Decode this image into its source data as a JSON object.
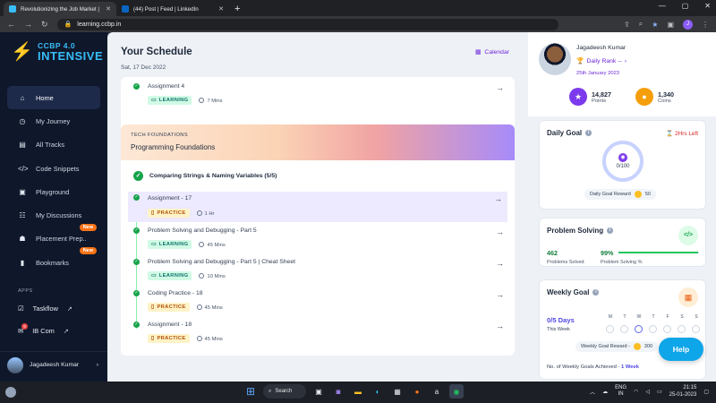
{
  "browser": {
    "tabs": [
      {
        "title": "Revolutionizing the Job Market |",
        "active": true,
        "icon": "ccbp-favicon"
      },
      {
        "title": "(44) Post | Feed | LinkedIn",
        "active": false,
        "icon": "linkedin-favicon"
      }
    ],
    "url": "learning.ccbp.in"
  },
  "sidebar": {
    "logo_line1": "CCBP 4.0",
    "logo_line2": "INTENSIVE",
    "items": [
      {
        "label": "Home",
        "icon": "home-icon",
        "active": true
      },
      {
        "label": "My Journey",
        "icon": "journey-icon"
      },
      {
        "label": "All Tracks",
        "icon": "tracks-icon"
      },
      {
        "label": "Code Snippets",
        "icon": "code-icon"
      },
      {
        "label": "Playground",
        "icon": "playground-icon"
      },
      {
        "label": "My Discussions",
        "icon": "discussion-icon"
      },
      {
        "label": "Placement Prep..",
        "icon": "placement-icon",
        "badge": "New"
      },
      {
        "label": "Bookmarks",
        "icon": "bookmark-icon",
        "badge": "New"
      }
    ],
    "apps_label": "APPS",
    "apps": [
      {
        "label": "Taskflow",
        "icon": "taskflow-icon"
      },
      {
        "label": "IB Com",
        "icon": "ibcom-icon",
        "count": "9"
      }
    ],
    "user_name": "Jagadeesh Kumar"
  },
  "schedule": {
    "title": "Your Schedule",
    "date": "Sat, 17 Dec 2022",
    "calendar_label": "Calendar",
    "top_item": {
      "title": "Assignment 4",
      "tag": "LEARNING",
      "duration": "7 Mins"
    },
    "section": {
      "banner_sub": "TECH FOUNDATIONS",
      "banner_title": "Programming Foundations",
      "heading": "Comparing Strings & Naming Variables (5/5)",
      "items": [
        {
          "title": "Assignment - 17",
          "tag": "PRACTICE",
          "duration": "1 Hr"
        },
        {
          "title": "Problem Solving and Debugging - Part 5",
          "tag": "LEARNING",
          "duration": "45 Mins"
        },
        {
          "title": "Problem Solving and Debugging - Part 5 | Cheat Sheet",
          "tag": "LEARNING",
          "duration": "10 Mins"
        },
        {
          "title": "Coding Practice - 18",
          "tag": "PRACTICE",
          "duration": "45 Mins"
        },
        {
          "title": "Assignment - 18",
          "tag": "PRACTICE",
          "duration": "45 Mins"
        }
      ]
    }
  },
  "profile": {
    "name": "Jagadeesh Kumar",
    "rank": "Daily Rank --",
    "date": "25th January 2023",
    "points_value": "14,827",
    "points_label": "Points",
    "coins_value": "1,340",
    "coins_label": "Coins"
  },
  "daily_goal": {
    "title": "Daily Goal",
    "time_left": "2Hrs Left",
    "progress": "0/100",
    "reward_label": "Daily Goal Reward",
    "reward_value": "50"
  },
  "problem_solving": {
    "title": "Problem Solving",
    "solved_value": "462",
    "solved_label": "Problems Solved",
    "percent_value": "99%",
    "percent_label": "Problem Solving %",
    "percent_fraction": 0.99
  },
  "weekly_goal": {
    "title": "Weekly Goal",
    "days": "0/5 Days",
    "this_week": "This Week",
    "weekdays": [
      "M",
      "T",
      "W",
      "T",
      "F",
      "S",
      "S"
    ],
    "reward_label": "Weekly Goal Reward -",
    "reward_value": "300",
    "achieved_label": "No. of Weekly Goals Achieved -",
    "achieved_value": "1 Week"
  },
  "help_label": "Help",
  "taskbar": {
    "search_label": "Search",
    "lang_line1": "ENG",
    "lang_line2": "IN",
    "time": "21:15",
    "date": "25-01-2023"
  },
  "colors": {
    "accent": "#6d28d9",
    "sidebar_bg": "#0f172a",
    "success": "#16a34a",
    "help": "#0ea5e9"
  }
}
